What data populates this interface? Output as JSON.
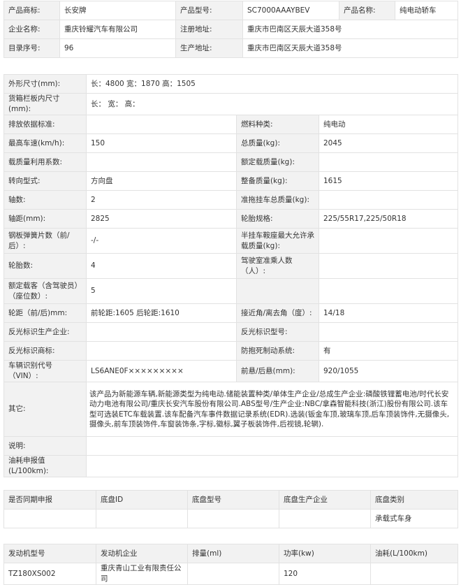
{
  "top": [
    [
      {
        "label": "产品商标:",
        "value": "长安牌"
      },
      {
        "label": "产品型号:",
        "value": "SC7000AAAYBEV"
      },
      {
        "label": "产品名称:",
        "value": "纯电动轿车"
      }
    ],
    [
      {
        "label": "企业名称:",
        "value": "重庆铃耀汽车有限公司"
      },
      {
        "label": "注册地址:",
        "value": "重庆市巴南区天辰大道358号"
      }
    ],
    [
      {
        "label": "目录序号:",
        "value": "96"
      },
      {
        "label": "生产地址:",
        "value": "重庆市巴南区天辰大道358号"
      }
    ]
  ],
  "spec_full": [
    {
      "label": "外形尺寸(mm):",
      "value": "长：4800 宽：1870 高：1505"
    },
    {
      "label": "货箱栏板内尺寸(mm):",
      "value": "长：  宽：  高："
    }
  ],
  "spec_pairs": [
    {
      "l1": "排放依据标准:",
      "v1": "",
      "l2": "燃料种类:",
      "v2": "纯电动"
    },
    {
      "l1": "最高车速(km/h):",
      "v1": "150",
      "l2": "总质量(kg):",
      "v2": "2045"
    },
    {
      "l1": "载质量利用系数:",
      "v1": "",
      "l2": "额定载质量(kg):",
      "v2": ""
    },
    {
      "l1": "转向型式:",
      "v1": "方向盘",
      "l2": "整备质量(kg):",
      "v2": "1615"
    },
    {
      "l1": "轴数:",
      "v1": "2",
      "l2": "准拖挂车总质量(kg):",
      "v2": ""
    },
    {
      "l1": "轴距(mm):",
      "v1": "2825",
      "l2": "轮胎规格:",
      "v2": "225/55R17,225/50R18"
    },
    {
      "l1": "钢板弹簧片数（前/后）:",
      "v1": "-/-",
      "l2": "半挂车鞍座最大允许承载质量(kg):",
      "v2": ""
    },
    {
      "l1": "轮胎数:",
      "v1": "4",
      "l2": "驾驶室准乘人数（人）:",
      "v2": ""
    },
    {
      "l1": "额定载客（含驾驶员）（座位数）:",
      "v1": "5",
      "l2": "",
      "v2": ""
    },
    {
      "l1": "轮距（前/后)mm:",
      "v1": "前轮距:1605 后轮距:1610",
      "l2": "接近角/离去角（度）:",
      "v2": "14/18"
    },
    {
      "l1": "反光标识生产企业:",
      "v1": "",
      "l2": "反光标识型号:",
      "v2": ""
    },
    {
      "l1": "反光标识商标:",
      "v1": "",
      "l2": "防抱死制动系统:",
      "v2": "有"
    },
    {
      "l1": "车辆识别代号（VIN）:",
      "v1": "LS6ANE0F×××××××××",
      "l2": "前悬/后悬(mm):",
      "v2": "920/1055"
    }
  ],
  "spec_bottom": [
    {
      "label": "其它:",
      "value": "该产品为新能源车辆,新能源类型为纯电动.储能装置种类/单体生产企业/总成生产企业:磷酸铁锂蓄电池/时代长安动力电池有限公司/重庆长安汽车股份有限公司.ABS型号/生产企业:NBC/拿森智能科技(浙江)股份有限公司.该车型可选装ETC车载装置.该车配备汽车事件数据记录系统(EDR).选装(钣金车顶,玻璃车顶,后车顶装饰件,无摄像头,摄像头,前车顶装饰件,车窗装饰条,字标,徽标,翼子板装饰件,后视镜,轮辋)."
    },
    {
      "label": "说明:",
      "value": ""
    },
    {
      "label": "油耗申报值(L/100km):",
      "value": ""
    }
  ],
  "chassis": {
    "headers": [
      "是否同期申报",
      "底盘ID",
      "底盘型号",
      "底盘生产企业",
      "底盘类别"
    ],
    "row": [
      "",
      "",
      "",
      "",
      "承载式车身"
    ]
  },
  "engine": {
    "headers": [
      "发动机型号",
      "发动机企业",
      "排量(ml)",
      "功率(kw)",
      "油耗(L/100km)"
    ],
    "row": [
      "TZ180XS002",
      "重庆青山工业有限责任公司",
      "",
      "120",
      ""
    ]
  }
}
